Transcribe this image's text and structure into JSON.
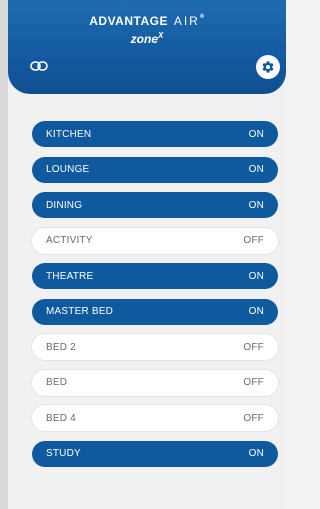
{
  "header": {
    "brand_main": "ADVANTAGE",
    "brand_air": "AIR",
    "brand_reg": "®",
    "model_name": "zone",
    "model_sup": "X"
  },
  "icons": {
    "link": "link-icon",
    "settings": "gear-icon"
  },
  "colors": {
    "header_blue": "#135aa0",
    "zone_on": "#0f5a9e",
    "zone_off": "#ffffff"
  },
  "zones": [
    {
      "name": "KITCHEN",
      "status": "ON"
    },
    {
      "name": "LOUNGE",
      "status": "ON"
    },
    {
      "name": "DINING",
      "status": "ON"
    },
    {
      "name": "ACTIVITY",
      "status": "OFF"
    },
    {
      "name": "THEATRE",
      "status": "ON"
    },
    {
      "name": "MASTER BED",
      "status": "ON"
    },
    {
      "name": "BED 2",
      "status": "OFF"
    },
    {
      "name": "BED",
      "status": "OFF"
    },
    {
      "name": "BED 4",
      "status": "OFF"
    },
    {
      "name": "STUDY",
      "status": "ON"
    }
  ]
}
